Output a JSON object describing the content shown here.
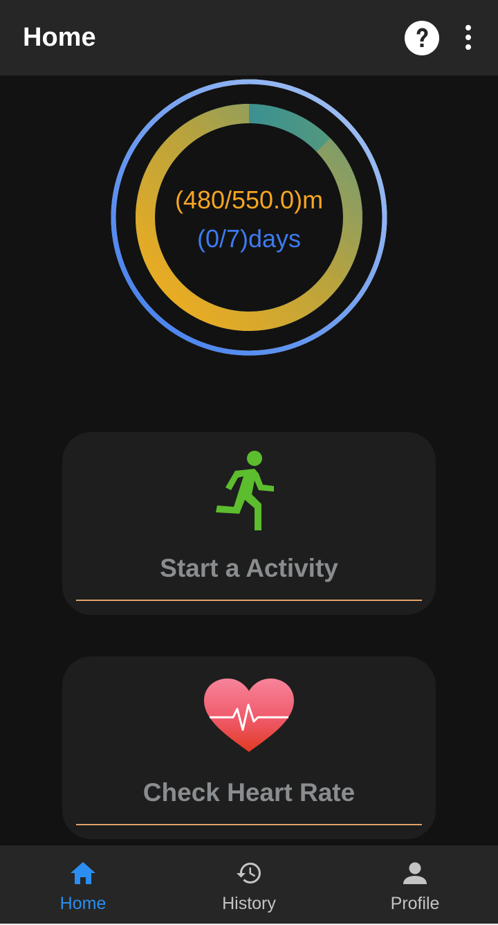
{
  "appbar": {
    "title": "Home",
    "help_icon": "help-circle-icon",
    "menu_icon": "more-vert-icon"
  },
  "progress": {
    "distance_text": "(480/550.0)m",
    "days_text": "(0/7)days",
    "distance_value": 480,
    "distance_goal": 550.0,
    "days_value": 0,
    "days_goal": 7,
    "colors": {
      "distance": "#f6a623",
      "days": "#3d7bf0"
    }
  },
  "cards": {
    "activity": {
      "label": "Start a Activity",
      "icon": "running-person-icon"
    },
    "heart": {
      "label": "Check Heart Rate",
      "icon": "heart-pulse-icon"
    }
  },
  "bottom_nav": {
    "items": [
      {
        "label": "Home",
        "icon": "home-icon",
        "active": true
      },
      {
        "label": "History",
        "icon": "history-icon",
        "active": false
      },
      {
        "label": "Profile",
        "icon": "person-icon",
        "active": false
      }
    ],
    "active_color": "#2b8ef0"
  }
}
